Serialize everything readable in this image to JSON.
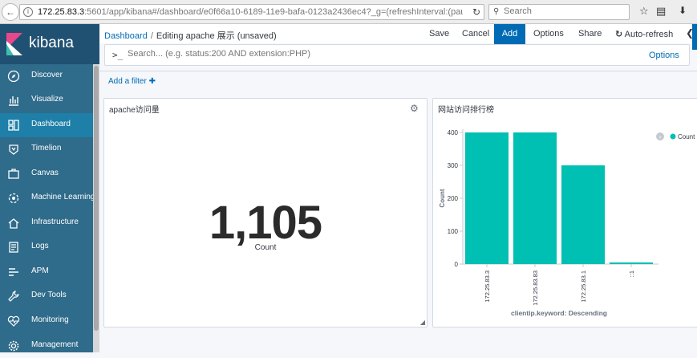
{
  "browser": {
    "url_host": "172.25.83.3",
    "url_rest": ":5601/app/kibana#/dashboard/e0f66a10-6189-11e9-bafa-0123a2436ec4?_g=(refreshInterval:(paus",
    "search_placeholder": "Search"
  },
  "sidebar": {
    "logo_text": "kibana",
    "items": [
      {
        "label": "Discover",
        "icon": "compass-icon"
      },
      {
        "label": "Visualize",
        "icon": "visualize-icon"
      },
      {
        "label": "Dashboard",
        "icon": "dashboard-icon",
        "active": true
      },
      {
        "label": "Timelion",
        "icon": "timelion-icon"
      },
      {
        "label": "Canvas",
        "icon": "canvas-icon"
      },
      {
        "label": "Machine Learning",
        "icon": "machine-learning-icon"
      },
      {
        "label": "Infrastructure",
        "icon": "infrastructure-icon"
      },
      {
        "label": "Logs",
        "icon": "logs-icon"
      },
      {
        "label": "APM",
        "icon": "apm-icon"
      },
      {
        "label": "Dev Tools",
        "icon": "wrench-icon"
      },
      {
        "label": "Monitoring",
        "icon": "heartbeat-icon"
      },
      {
        "label": "Management",
        "icon": "gear-icon"
      }
    ]
  },
  "header": {
    "breadcrumb_link": "Dashboard",
    "breadcrumb_sep": "/",
    "breadcrumb_current": "Editing apache 展示 (unsaved)",
    "menu": {
      "save": "Save",
      "cancel": "Cancel",
      "add": "Add",
      "options": "Options",
      "share": "Share",
      "auto_refresh": "Auto-refresh"
    }
  },
  "query": {
    "prompt": ">_",
    "placeholder": "Search... (e.g. status:200 AND extension:PHP)",
    "options_label": "Options"
  },
  "filters": {
    "add_filter": "Add a filter"
  },
  "panels": {
    "metric": {
      "title": "apache访问量",
      "value": "1,105",
      "label": "Count"
    },
    "bar": {
      "title": "网站访问排行榜"
    }
  },
  "chart_data": {
    "type": "bar",
    "title": "网站访问排行榜",
    "xlabel": "clientip.keyword: Descending",
    "ylabel": "Count",
    "categories": [
      "172.25.83.3",
      "172.25.83.83",
      "172.25.83.1",
      "::1"
    ],
    "values": [
      400,
      400,
      300,
      5
    ],
    "ylim": [
      0,
      400
    ],
    "yticks": [
      0,
      100,
      200,
      300,
      400
    ],
    "legend": [
      "Count"
    ],
    "legend_position": "top-right",
    "color": "#00bfb3",
    "grid": false
  },
  "colors": {
    "sidebar": "#2f6b8a",
    "sidebar_active": "#1e7fa8",
    "accent": "#006bb4",
    "bar": "#00bfb3"
  }
}
